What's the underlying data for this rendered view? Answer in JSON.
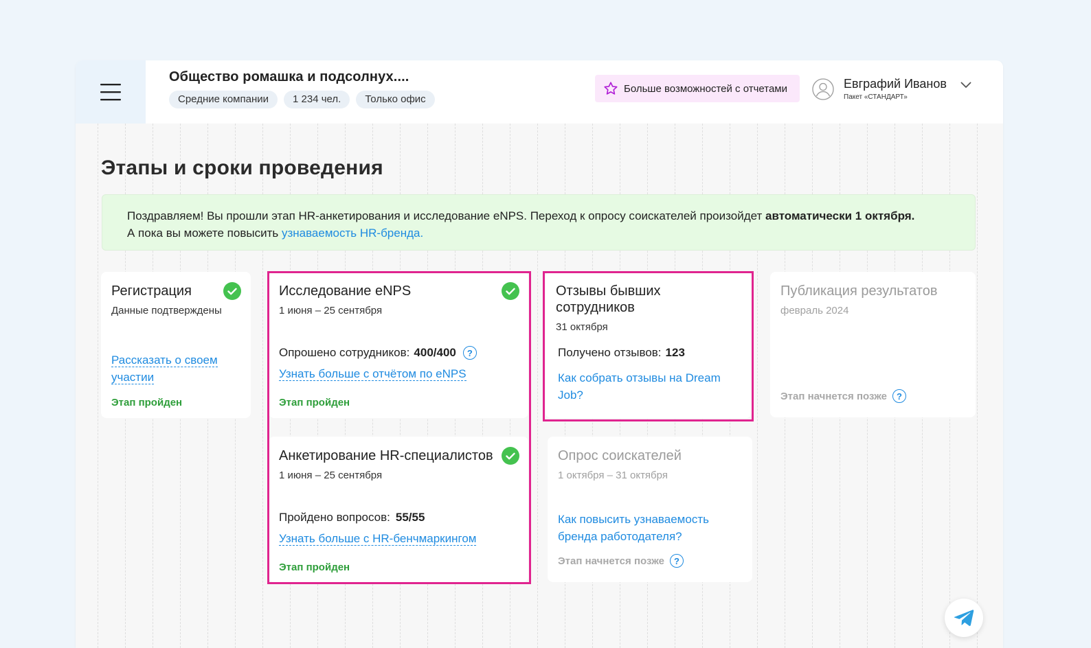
{
  "header": {
    "company_name": "Общество ромашка и подсолнух....",
    "tags": [
      "Средние компании",
      "1 234 чел.",
      "Только офис"
    ],
    "promo_label": "Больше возможностей с отчетами",
    "user_name": "Евграфий Иванов",
    "user_pack": "Пакет «СТАНДАРТ»"
  },
  "page_title": "Этапы и сроки проведения",
  "notice": {
    "text_1": "Поздравляем! Вы прошли этап HR-анкетирования и исследование eNPS. Переход к опросу соискателей произойдет ",
    "text_bold": "автоматически 1 октября.",
    "text_2": "А пока вы можете повысить ",
    "link": "узнаваемость HR-бренда."
  },
  "cards": {
    "registration": {
      "title": "Регистрация",
      "subtitle": "Данные подтверждены",
      "link_1": "Рассказать о своем",
      "link_2": "участии",
      "status": "Этап пройден"
    },
    "enps": {
      "title": "Исследование eNPS",
      "date": "1 июня – 25 сентября",
      "stat_label": "Опрошено сотрудников:",
      "stat_value": "400/400",
      "link": "Узнать больше с отчётом по eNPS",
      "status": "Этап пройден"
    },
    "hr_survey": {
      "title": "Анкетирование HR-специалистов",
      "date": "1 июня – 25 сентября",
      "stat_label": "Пройдено вопросов:",
      "stat_value": "55/55",
      "link": "Узнать больше с HR-бенчмаркингом",
      "status": "Этап пройден"
    },
    "reviews": {
      "title_1": "Отзывы бывших",
      "title_2": "сотрудников",
      "date": "31 октября",
      "stat_label": "Получено отзывов:",
      "stat_value": "123",
      "link_1": "Как собрать отзывы на Dream",
      "link_2": "Job?"
    },
    "candidates": {
      "title": "Опрос соискателей",
      "date": "1 октября – 31 октября",
      "link_1": "Как повысить узнаваемость",
      "link_2": "бренда работодателя?",
      "status": "Этап начнется позже"
    },
    "publication": {
      "title": "Публикация результатов",
      "date": "февраль 2024",
      "status": "Этап начнется позже"
    }
  },
  "help_icon_glyph": "?",
  "colors": {
    "accent_link": "#1f8be0",
    "done_green": "#2e9e3a",
    "check_green": "#44c24f",
    "highlight_pink": "#e0248f",
    "notice_bg": "#e6fae3",
    "promo_bg": "#fbe8fb"
  }
}
